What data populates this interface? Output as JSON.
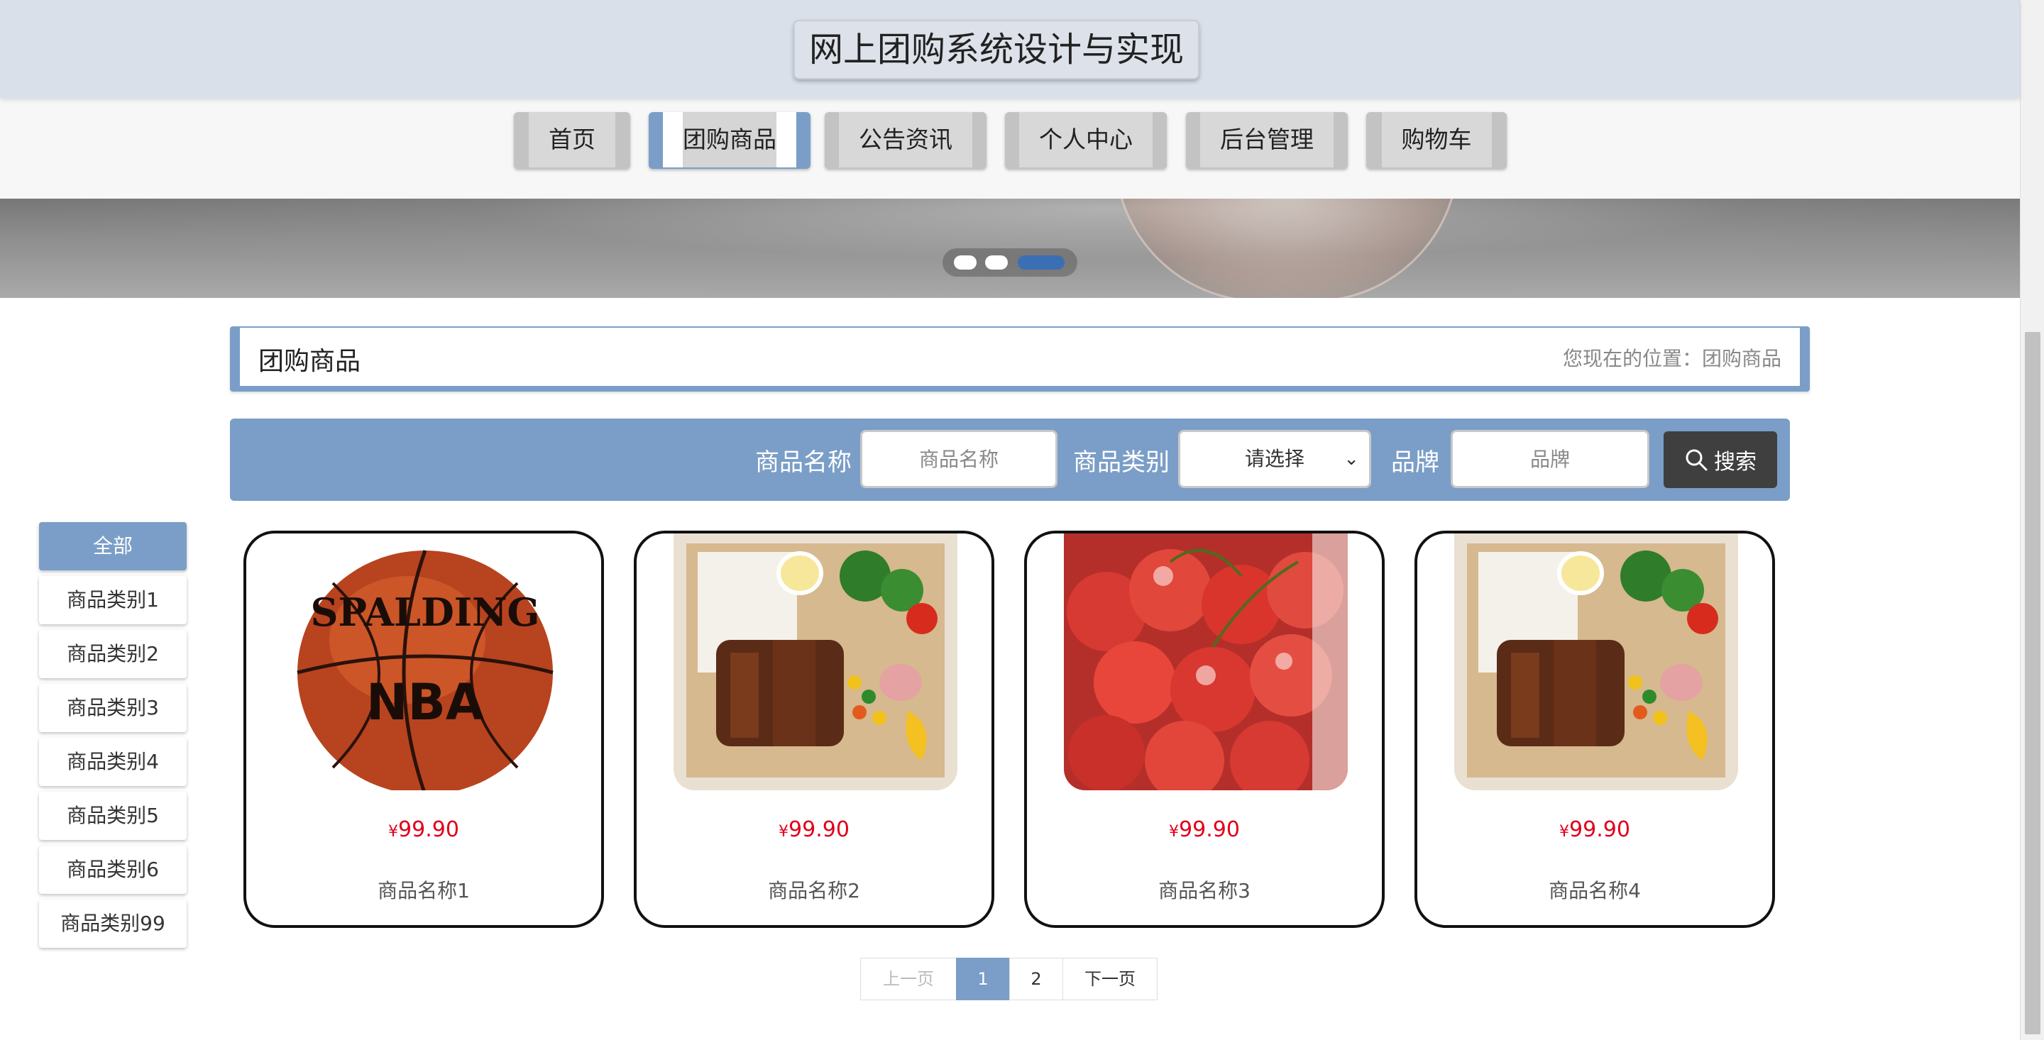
{
  "site": {
    "title": "网上团购系统设计与实现"
  },
  "nav": [
    {
      "label": "首页"
    },
    {
      "label": "团购商品"
    },
    {
      "label": "公告资讯"
    },
    {
      "label": "个人中心"
    },
    {
      "label": "后台管理"
    },
    {
      "label": "购物车"
    }
  ],
  "page": {
    "title": "团购商品",
    "breadcrumb": "您现在的位置：团购商品"
  },
  "search": {
    "name_label": "商品名称",
    "name_placeholder": "商品名称",
    "category_label": "商品类别",
    "category_value": "请选择",
    "brand_label": "品牌",
    "brand_placeholder": "品牌",
    "button_label": "搜索"
  },
  "categories": [
    {
      "label": "全部"
    },
    {
      "label": "商品类别1"
    },
    {
      "label": "商品类别2"
    },
    {
      "label": "商品类别3"
    },
    {
      "label": "商品类别4"
    },
    {
      "label": "商品类别5"
    },
    {
      "label": "商品类别6"
    },
    {
      "label": "商品类别99"
    }
  ],
  "products": [
    {
      "currency": "¥",
      "price": "99.90",
      "name": "商品名称1",
      "image": "basketball-image"
    },
    {
      "currency": "¥",
      "price": "99.90",
      "name": "商品名称2",
      "image": "bento-image"
    },
    {
      "currency": "¥",
      "price": "99.90",
      "name": "商品名称3",
      "image": "cherries-image"
    },
    {
      "currency": "¥",
      "price": "99.90",
      "name": "商品名称4",
      "image": "bento-image"
    }
  ],
  "pagination": {
    "prev": "上一页",
    "pages": [
      "1",
      "2"
    ],
    "next": "下一页",
    "current": "1"
  },
  "colors": {
    "accent": "#7a9ec7",
    "header_bg": "#d9e0ea",
    "price": "#e0001a",
    "search_button": "#3f3f3f"
  }
}
